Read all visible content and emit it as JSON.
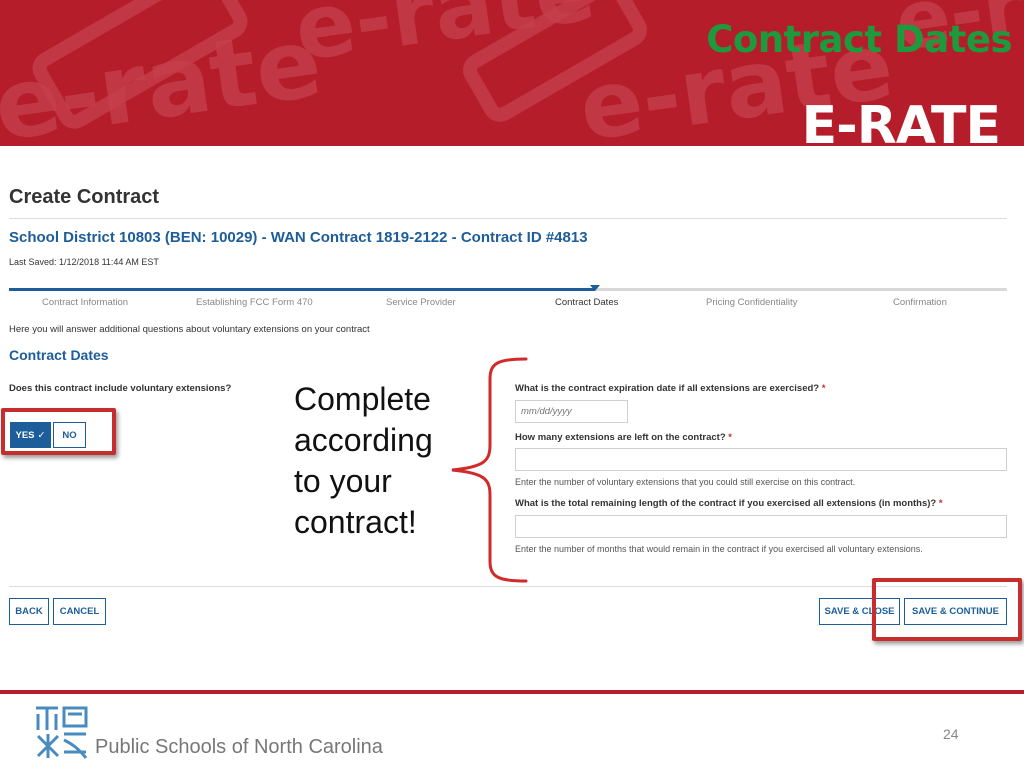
{
  "slide": {
    "title": "Contract Dates",
    "brand": "E-RATE",
    "watermark_text": "e-rate",
    "page_number": "24",
    "footer_org": "Public Schools of North Carolina",
    "annotation": [
      "Complete",
      "according",
      "to your",
      "contract!"
    ]
  },
  "colors": {
    "banner_red": "#b51d2b",
    "title_green": "#1e9a3e",
    "accent_blue": "#1d5d99",
    "highlight_red": "#c62d2d"
  },
  "form": {
    "page_title": "Create Contract",
    "contract_heading": "School District 10803 (BEN: 10029) - WAN Contract 1819-2122 - Contract ID #4813",
    "last_saved": "Last Saved: 1/12/2018 11:44 AM EST",
    "steps": [
      {
        "label": "Contract Information",
        "state": "done"
      },
      {
        "label": "Establishing FCC Form 470",
        "state": "done"
      },
      {
        "label": "Service Provider",
        "state": "done"
      },
      {
        "label": "Contract Dates",
        "state": "current"
      },
      {
        "label": "Pricing Confidentiality",
        "state": "upcoming"
      },
      {
        "label": "Confirmation",
        "state": "upcoming"
      }
    ],
    "intro": "Here you will answer additional questions about voluntary extensions on your contract",
    "section_title": "Contract Dates",
    "question_extensions": "Does this contract include voluntary extensions?",
    "yes_label": "YES",
    "no_label": "NO",
    "selected": "YES",
    "fields": [
      {
        "label": "What is the contract expiration date if all extensions are exercised?",
        "required": "*",
        "value": "",
        "placeholder": "mm/dd/yyyy",
        "help": ""
      },
      {
        "label": "How many extensions are left on the contract?",
        "required": "*",
        "value": "",
        "placeholder": "",
        "help": "Enter the number of voluntary extensions that you could still exercise on this contract."
      },
      {
        "label": "What is the total remaining length of the contract if you exercised all extensions (in months)?",
        "required": "*",
        "value": "",
        "placeholder": "",
        "help": "Enter the number of months that would remain in the contract if you exercised all voluntary extensions."
      }
    ],
    "buttons": {
      "back": "BACK",
      "cancel": "CANCEL",
      "save_close": "SAVE & CLOSE",
      "save_continue": "SAVE & CONTINUE"
    }
  }
}
